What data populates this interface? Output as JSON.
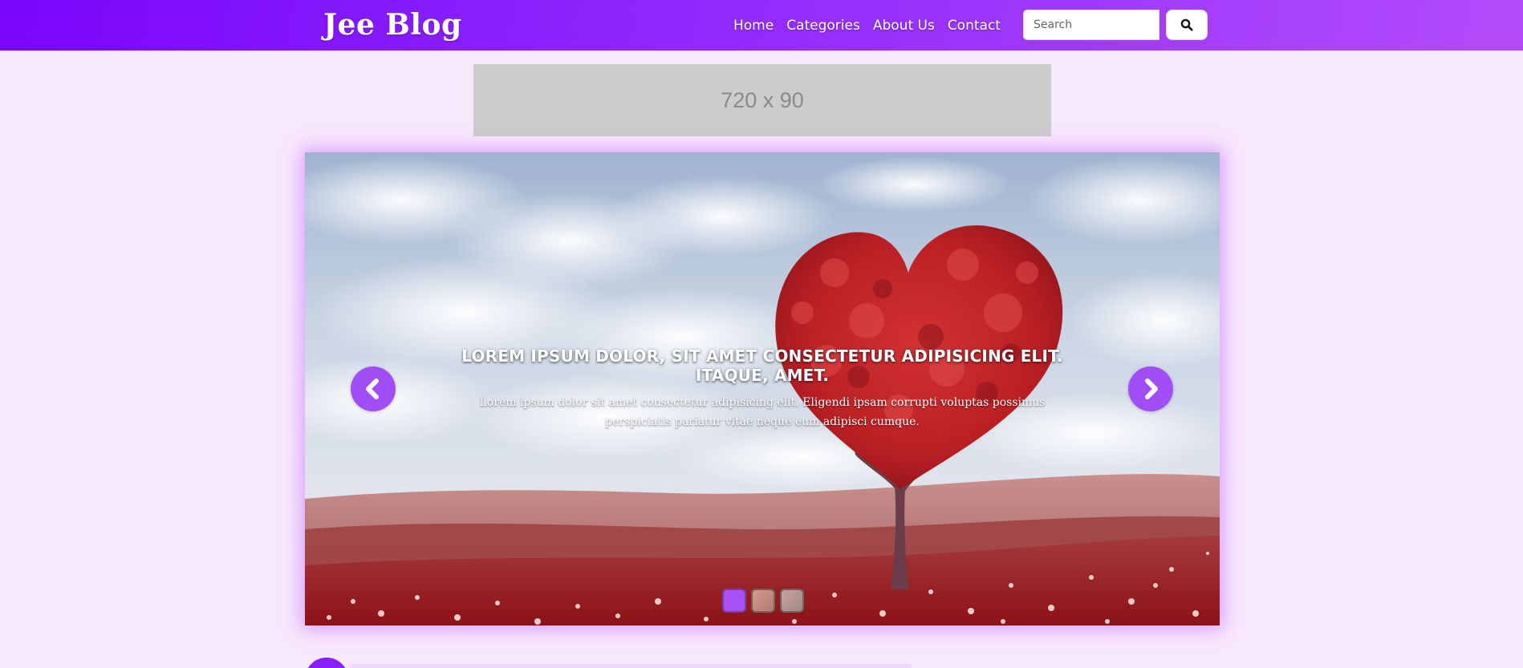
{
  "header": {
    "brand": "Jee Blog",
    "nav": [
      "Home",
      "Categories",
      "About Us",
      "Contact"
    ],
    "search_placeholder": "Search",
    "search_icon": "search-icon"
  },
  "ad": {
    "label": "720 x 90"
  },
  "carousel": {
    "title": "LOREM IPSUM DOLOR, SIT AMET CONSECTETUR ADIPISICING ELIT. ITAQUE, AMET.",
    "text": "Lorem ipsum dolor sit amet consectetur adipisicing elit. Eligendi ipsam corrupti voluptas possimus perspiciatis pariatur vitae neque eum adipisci cumque.",
    "prev_icon": "chevron-left-icon",
    "next_icon": "chevron-right-icon",
    "slide_count": 3,
    "active_slide": 1
  },
  "colors": {
    "accent": "#9128fd",
    "page_bg": "#f8e8fc",
    "control_bg": "#a14ef6"
  }
}
